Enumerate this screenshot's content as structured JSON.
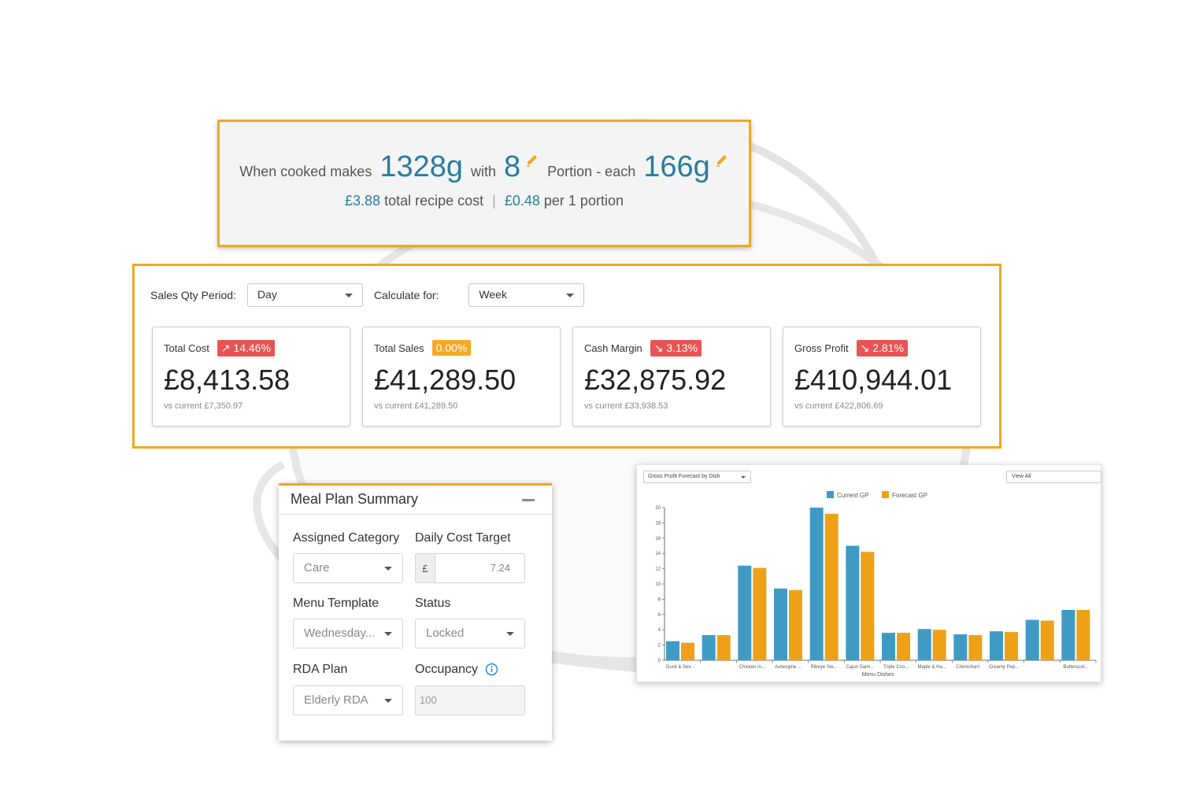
{
  "colors": {
    "accent": "#f0a81e",
    "blue_value": "#2a7d9c",
    "badge_red": "#e85353",
    "badge_amber": "#f7a823",
    "series_current": "#3f9bc4",
    "series_forecast": "#eea117"
  },
  "yield": {
    "prefix": "When cooked makes",
    "total_weight": "1328g",
    "with_label": "with",
    "portions": "8",
    "portion_label": "Portion - each",
    "portion_weight": "166g",
    "total_cost": "£3.88",
    "total_cost_label": "total recipe cost",
    "separator": "|",
    "per_portion_cost": "£0.48",
    "per_portion_label": "per 1 portion"
  },
  "filters": {
    "period_label": "Sales Qty Period:",
    "period_value": "Day",
    "calc_label": "Calculate for:",
    "calc_value": "Week"
  },
  "kpis": [
    {
      "title": "Total Cost",
      "badge": "↗ 14.46%",
      "value": "£8,413.58",
      "sub": "vs current £7,350.97"
    },
    {
      "title": "Total Sales",
      "badge": "0.00%",
      "value": "£41,289.50",
      "sub": "vs current £41,289.50"
    },
    {
      "title": "Cash Margin",
      "badge": "↘ 3.13%",
      "value": "£32,875.92",
      "sub": "vs current £33,938.53"
    },
    {
      "title": "Gross Profit",
      "badge": "↘ 2.81%",
      "value": "£410,944.01",
      "sub": "vs current £422,806.69"
    }
  ],
  "meal_plan": {
    "title": "Meal Plan Summary",
    "assigned_category_label": "Assigned Category",
    "assigned_category_value": "Care",
    "daily_cost_label": "Daily Cost Target",
    "daily_cost_prefix": "£",
    "daily_cost_value": "7.24",
    "menu_template_label": "Menu Template",
    "menu_template_value": "Wednesday...",
    "status_label": "Status",
    "status_value": "Locked",
    "rda_label": "RDA Plan",
    "rda_value": "Elderly RDA",
    "occupancy_label": "Occupancy",
    "occupancy_value": "100"
  },
  "chart_panel": {
    "select_label": "Gross Profit Forecast by Dish",
    "view_label": "View All"
  },
  "chart_data": {
    "type": "bar",
    "xlabel": "Menu Dishes",
    "ylabel": "",
    "ylim": [
      0,
      20
    ],
    "yticks": [
      0,
      2,
      4,
      6,
      8,
      10,
      12,
      14,
      16,
      18,
      20
    ],
    "legend_position": "top",
    "categories": [
      "Duck & Sev...",
      "",
      "Chicken in...",
      "Aubergine ...",
      "Ribeye Ste...",
      "Cajun Salm...",
      "Triple Cco...",
      "Maple & Ha...",
      "Chimichurri",
      "Creamy Pep...",
      "",
      "Butterscot..."
    ],
    "series": [
      {
        "name": "Current GP",
        "values": [
          2.5,
          3.3,
          12.4,
          9.4,
          20.0,
          15.0,
          3.6,
          4.1,
          3.4,
          3.8,
          5.3,
          6.6
        ]
      },
      {
        "name": "Forecast GP",
        "values": [
          2.3,
          3.3,
          12.1,
          9.2,
          19.2,
          14.2,
          3.6,
          4.0,
          3.3,
          3.7,
          5.2,
          6.6
        ]
      }
    ]
  }
}
